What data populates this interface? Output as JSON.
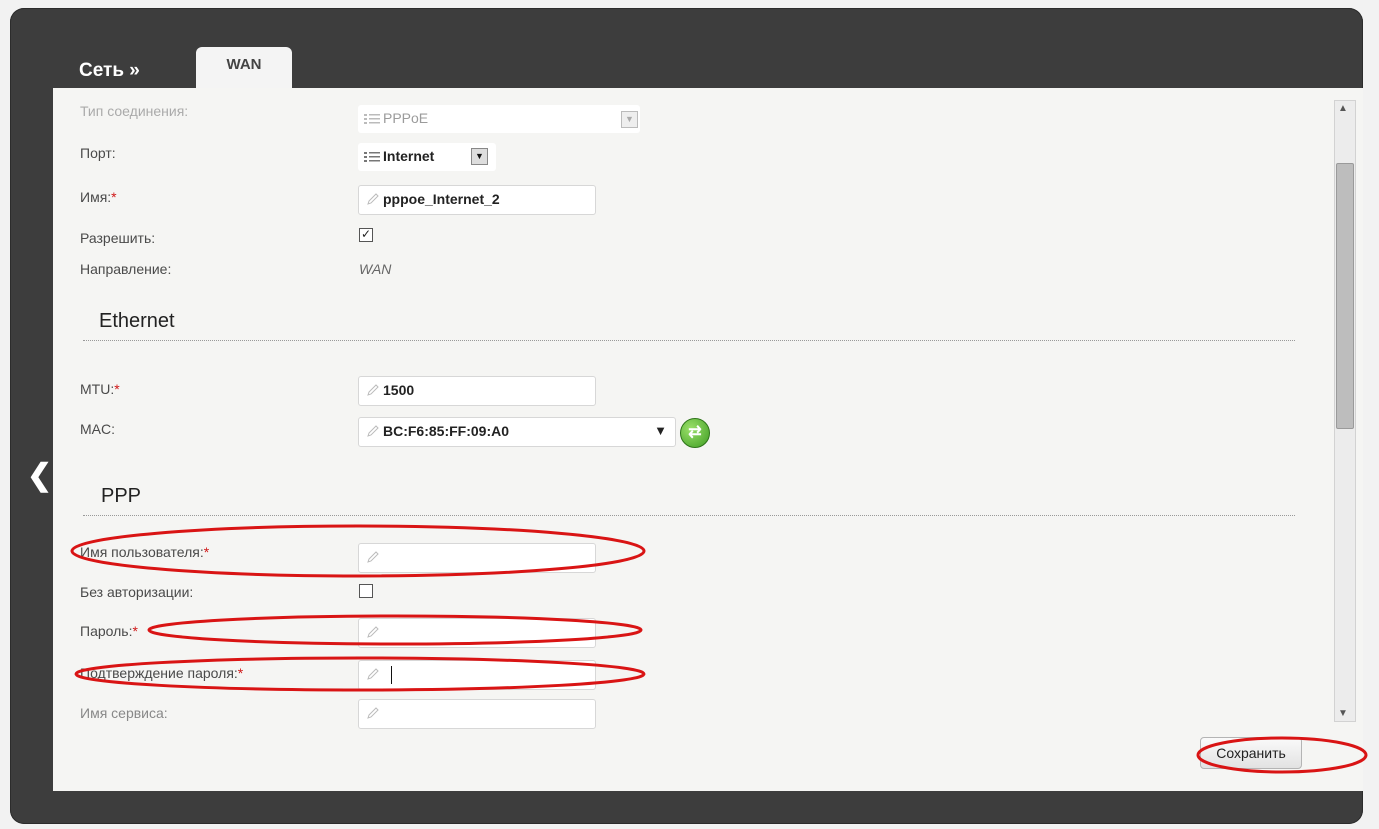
{
  "header": {
    "breadcrumb": "Сеть »",
    "tab": "WAN"
  },
  "form": {
    "conn_type_label": "Тип соединения:",
    "conn_type_value": "PPPoE",
    "port_label": "Порт:",
    "port_value": "Internet",
    "name_label": "Имя:",
    "name_value": "pppoe_Internet_2",
    "enable_label": "Разрешить:",
    "enable_checked": true,
    "direction_label": "Направление:",
    "direction_value": "WAN"
  },
  "ethernet": {
    "title": "Ethernet",
    "mtu_label": "MTU:",
    "mtu_value": "1500",
    "mac_label": "MAC:",
    "mac_value": "BC:F6:85:FF:09:A0"
  },
  "ppp": {
    "title": "PPP",
    "username_label": "Имя пользователя:",
    "username_value": "",
    "noauth_label": "Без авторизации:",
    "noauth_checked": false,
    "password_label": "Пароль:",
    "password_value": "",
    "confirm_label": "Подтверждение пароля:",
    "confirm_value": "",
    "service_label": "Имя сервиса:",
    "service_value": ""
  },
  "actions": {
    "save_label": "Сохранить"
  },
  "required_mark": "*",
  "colors": {
    "frame": "#3d3d3d",
    "panel": "#f5f5f3",
    "required": "#d01818",
    "annotation": "#d91414"
  }
}
